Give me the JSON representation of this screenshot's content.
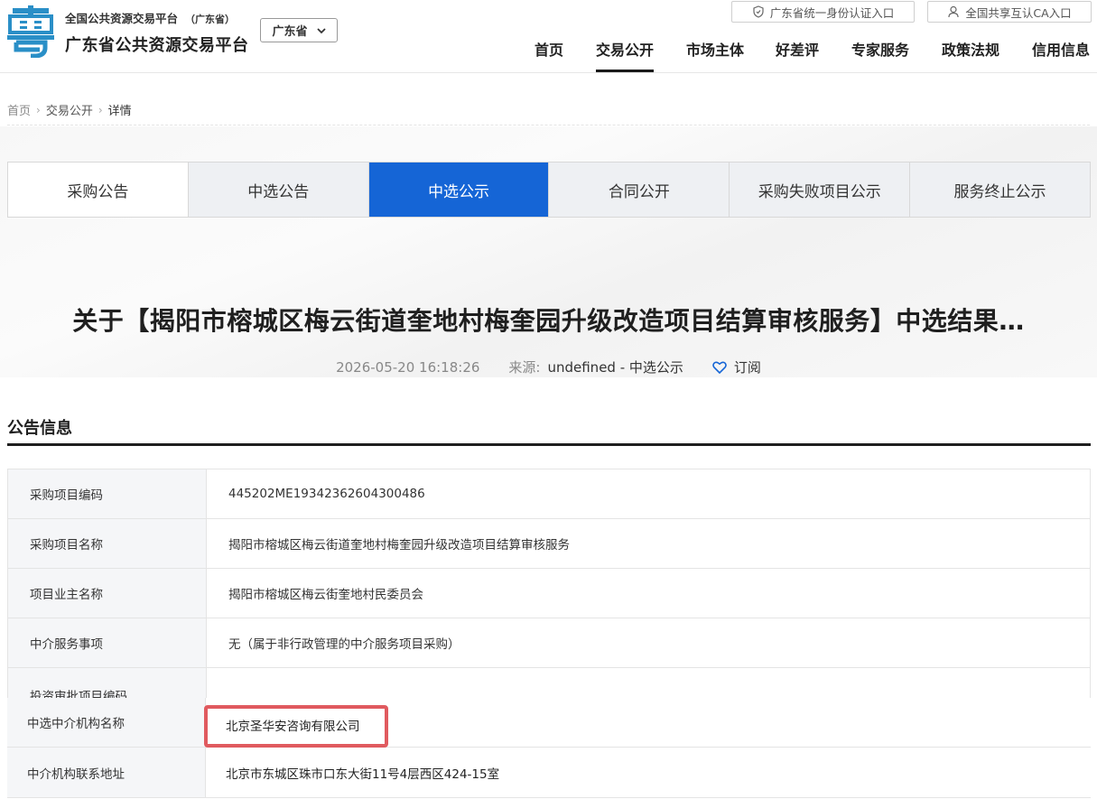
{
  "header": {
    "brand_top": "全国公共资源交易平台",
    "brand_region_tag": "（广东省）",
    "brand_main": "广东省公共资源交易平台",
    "region_select": "广东省",
    "auth_btn": "广东省统一身份认证入口",
    "ca_btn": "全国共享互认CA入口",
    "nav": [
      "首页",
      "交易公开",
      "市场主体",
      "好差评",
      "专家服务",
      "政策法规",
      "信用信息"
    ],
    "nav_active": "交易公开",
    "logo_color": "#2a8fc7"
  },
  "breadcrumb": [
    "首页",
    "交易公开",
    "详情"
  ],
  "tabs": [
    "采购公告",
    "中选公告",
    "中选公示",
    "合同公开",
    "采购失败项目公示",
    "服务终止公示"
  ],
  "active_tab": "中选公示",
  "accent_color": "#1565d6",
  "article": {
    "title": "关于【揭阳市榕城区梅云街道奎地村梅奎园升级改造项目结算审核服务】中选结果…",
    "date": "2026-05-20 16:18:26",
    "source_label": "来源:",
    "source": "undefined - 中选公示",
    "subscribe": "订阅"
  },
  "section_title": "公告信息",
  "info_rows": [
    {
      "key": "采购项目编码",
      "value": "445202ME19342362604300486"
    },
    {
      "key": "采购项目名称",
      "value": "揭阳市榕城区梅云街道奎地村梅奎园升级改造项目结算审核服务"
    },
    {
      "key": "项目业主名称",
      "value": "揭阳市榕城区梅云街奎地村民委员会"
    },
    {
      "key": "中介服务事项",
      "value": "无（属于非行政管理的中介服务项目采购）"
    },
    {
      "key": "投资审批项目编码",
      "value": ""
    }
  ],
  "highlight_rows": [
    {
      "key": "中选中介机构名称",
      "value": "北京圣华安咨询有限公司"
    },
    {
      "key": "中介机构联系地址",
      "value": "北京市东城区珠市口东大街11号4层西区424-15室"
    }
  ],
  "highlight_color": "#e05a5f"
}
